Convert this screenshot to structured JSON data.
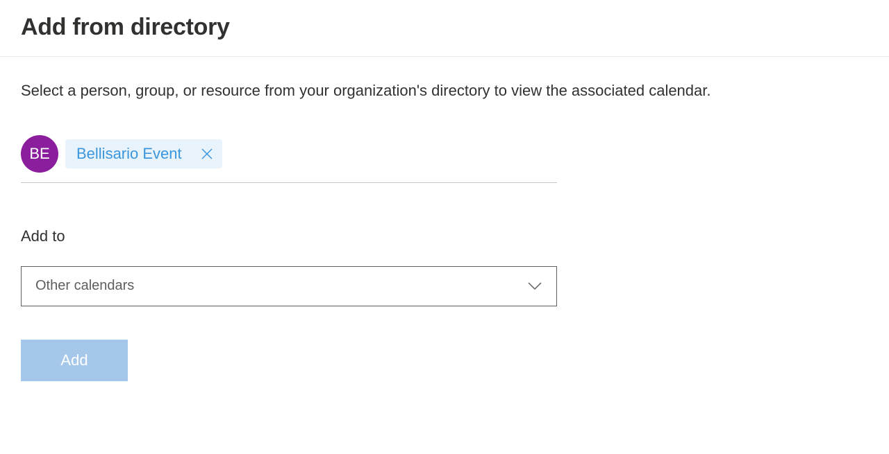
{
  "header": {
    "title": "Add from directory"
  },
  "instruction": "Select a person, group, or resource from your organization's directory to view the associated calendar.",
  "selection": {
    "avatar_initials": "BE",
    "chip_label": "Bellisario Event"
  },
  "add_to": {
    "label": "Add to",
    "selected": "Other calendars"
  },
  "buttons": {
    "add": "Add"
  },
  "colors": {
    "avatar_bg": "#8a1e9c",
    "chip_bg": "#e9f3fc",
    "chip_text": "#3a96dd",
    "button_bg": "#a4c7ea"
  }
}
